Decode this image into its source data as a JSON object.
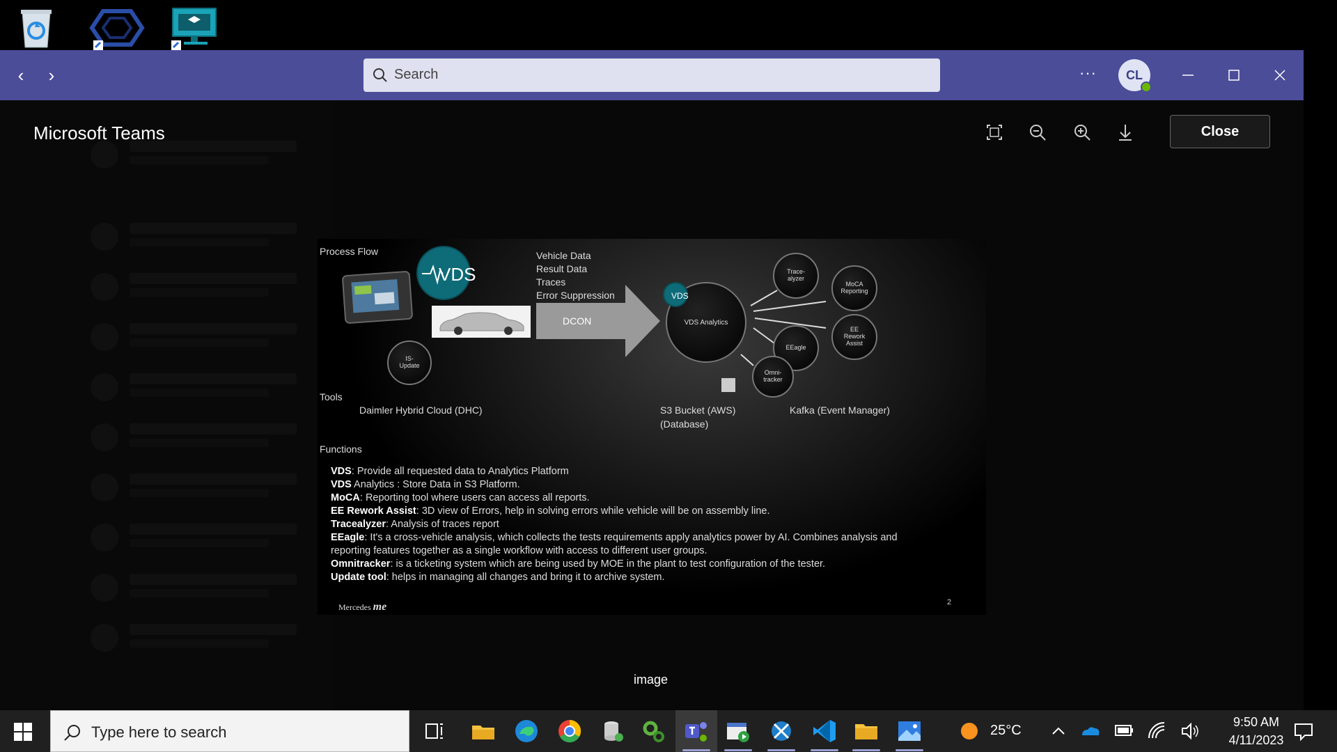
{
  "desktop": {
    "icons": [
      "recycle-bin",
      "app-shortcut",
      "remote-classroom-shortcut"
    ]
  },
  "teams": {
    "search_placeholder": "Search",
    "avatar_initials": "CL",
    "more_label": "···",
    "viewer": {
      "title": "Microsoft Teams",
      "close_label": "Close",
      "caption": "image"
    }
  },
  "slide": {
    "process_flow_label": "Process Flow",
    "vds_logo_text": "VDS",
    "data_items": [
      "Vehicle Data",
      "Result Data",
      "Traces",
      "Error Suppression"
    ],
    "dcon_label": "DCON",
    "is_update_label": "IS-\nUpdate",
    "analytics_label": "VDS Analytics",
    "analytics_logo_text": "VDS",
    "tools_label": "Tools",
    "dhc_label": "Daimler Hybrid Cloud (DHC)",
    "s3_label_1": "S3 Bucket (AWS)",
    "s3_label_2": "(Database)",
    "kafka_label": "Kafka (Event Manager)",
    "nodes": {
      "tracealyzer": "Trace-\nalyzer",
      "moca": "MoCA\nReporting",
      "ee_rework": "EE\nRework\nAssist",
      "eeagle": "EEagle",
      "omnitracker": "Omni-\ntracker"
    },
    "functions_label": "Functions",
    "functions": [
      {
        "term": "VDS",
        "text": ": Provide all requested data to Analytics Platform"
      },
      {
        "term": "VDS",
        "text": " Analytics :  Store Data in S3 Platform."
      },
      {
        "term": "MoCA",
        "text": ": Reporting tool where users can access all reports."
      },
      {
        "term": "EE Rework Assist",
        "text": ": 3D view of Errors, help in solving errors while vehicle will be on assembly line."
      },
      {
        "term": "Tracealyzer",
        "text": ": Analysis of traces report"
      },
      {
        "term": "EEagle",
        "text": ": It's a cross-vehicle analysis, which collects the tests requirements apply analytics power by AI. Combines analysis and"
      },
      {
        "term": "",
        "text": "reporting features together  as  a single workflow with access to different user groups."
      },
      {
        "term": "Omnitracker",
        "text": ": is a ticketing system which are being used by MOE in the plant to test configuration  of the tester."
      },
      {
        "term": "Update tool",
        "text": ": helps in managing all changes and bring it to archive system."
      }
    ],
    "brand_prefix": "Mercedes",
    "brand_suffix": "me",
    "page_number": "2"
  },
  "taskbar": {
    "search_placeholder": "Type here to search",
    "weather_temp": "25°C",
    "time": "9:50 AM",
    "date": "4/11/2023",
    "pinned": [
      "task-view",
      "file-explorer",
      "edge",
      "chrome",
      "database-tool",
      "settings-gear",
      "teams",
      "media-creator",
      "xcode-like-tool",
      "vscode",
      "folder",
      "photos"
    ]
  },
  "colors": {
    "titlebar": "#4b4d99",
    "vds_teal": "#0e6b78",
    "presence": "#6bb700",
    "weather_sun": "#f7931e"
  }
}
